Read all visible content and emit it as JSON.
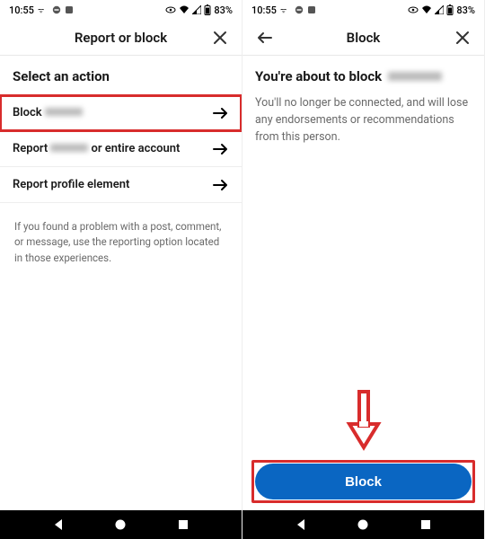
{
  "status": {
    "time": "10:55",
    "battery": "83%"
  },
  "left": {
    "header": {
      "title": "Report or block"
    },
    "section_title": "Select an action",
    "actions": {
      "block": "Block",
      "report_mid": "or entire account",
      "report_prefix": "Report",
      "report_profile": "Report profile element"
    },
    "helper": "If you found a problem with a post, comment, or message, use the reporting option located in those experiences."
  },
  "right": {
    "header": {
      "title": "Block"
    },
    "heading_prefix": "You're about to block",
    "body": "You'll no longer be connected, and will lose any endorsements or recommendations from this person.",
    "button": "Block"
  }
}
